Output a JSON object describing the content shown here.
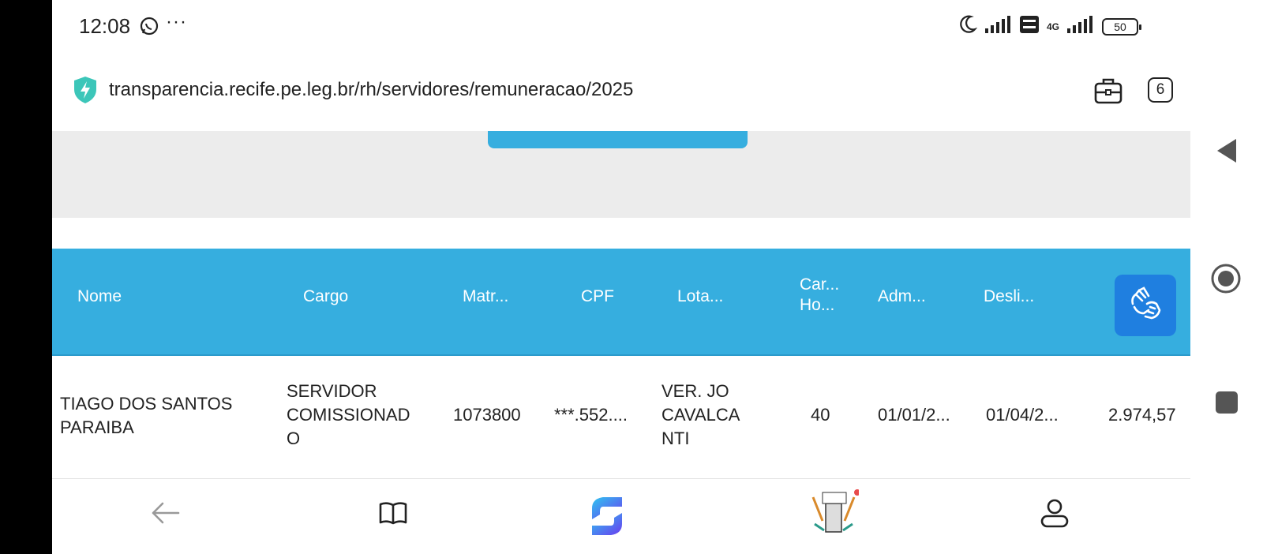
{
  "status_bar": {
    "time": "12:08",
    "dots": "···",
    "network": "4G",
    "battery": "50"
  },
  "browser": {
    "url": "transparencia.recife.pe.leg.br/rh/servidores/remuneracao/2025",
    "tab_count": "6"
  },
  "table": {
    "headers": [
      "Nome",
      "Cargo",
      "Matr...",
      "CPF",
      "Lota...",
      "Car...\nHo...",
      "Adm...",
      "Desli..."
    ],
    "rows": [
      {
        "nome": "TIAGO DOS SANTOS\nPARAIBA",
        "cargo": "SERVIDOR\nCOMISSIONAD\nO",
        "matricula": "1073800",
        "cpf": "***.552....",
        "lotacao": "VER. JO\nCAVALCA\nNTI",
        "carga_horaria": "40",
        "admissao": "01/01/2...",
        "desligamento": "01/04/2...",
        "valor": "2.974,57"
      }
    ]
  },
  "icons": {
    "whatsapp": "whatsapp-icon",
    "moon": "moon-icon",
    "signal": "signal-icon",
    "volte": "volte-icon",
    "shield": "shield-icon",
    "briefcase": "briefcase-icon",
    "libras": "libras-hands-icon",
    "back": "back-arrow-icon",
    "book": "book-icon",
    "app_logo": "app-logo-icon",
    "game": "game-icon",
    "profile": "profile-icon"
  },
  "colors": {
    "header_blue": "#36aedf",
    "libras_blue": "#1f7fe0",
    "gray_bg": "#ececec",
    "shield_teal": "#3cc6b9"
  }
}
